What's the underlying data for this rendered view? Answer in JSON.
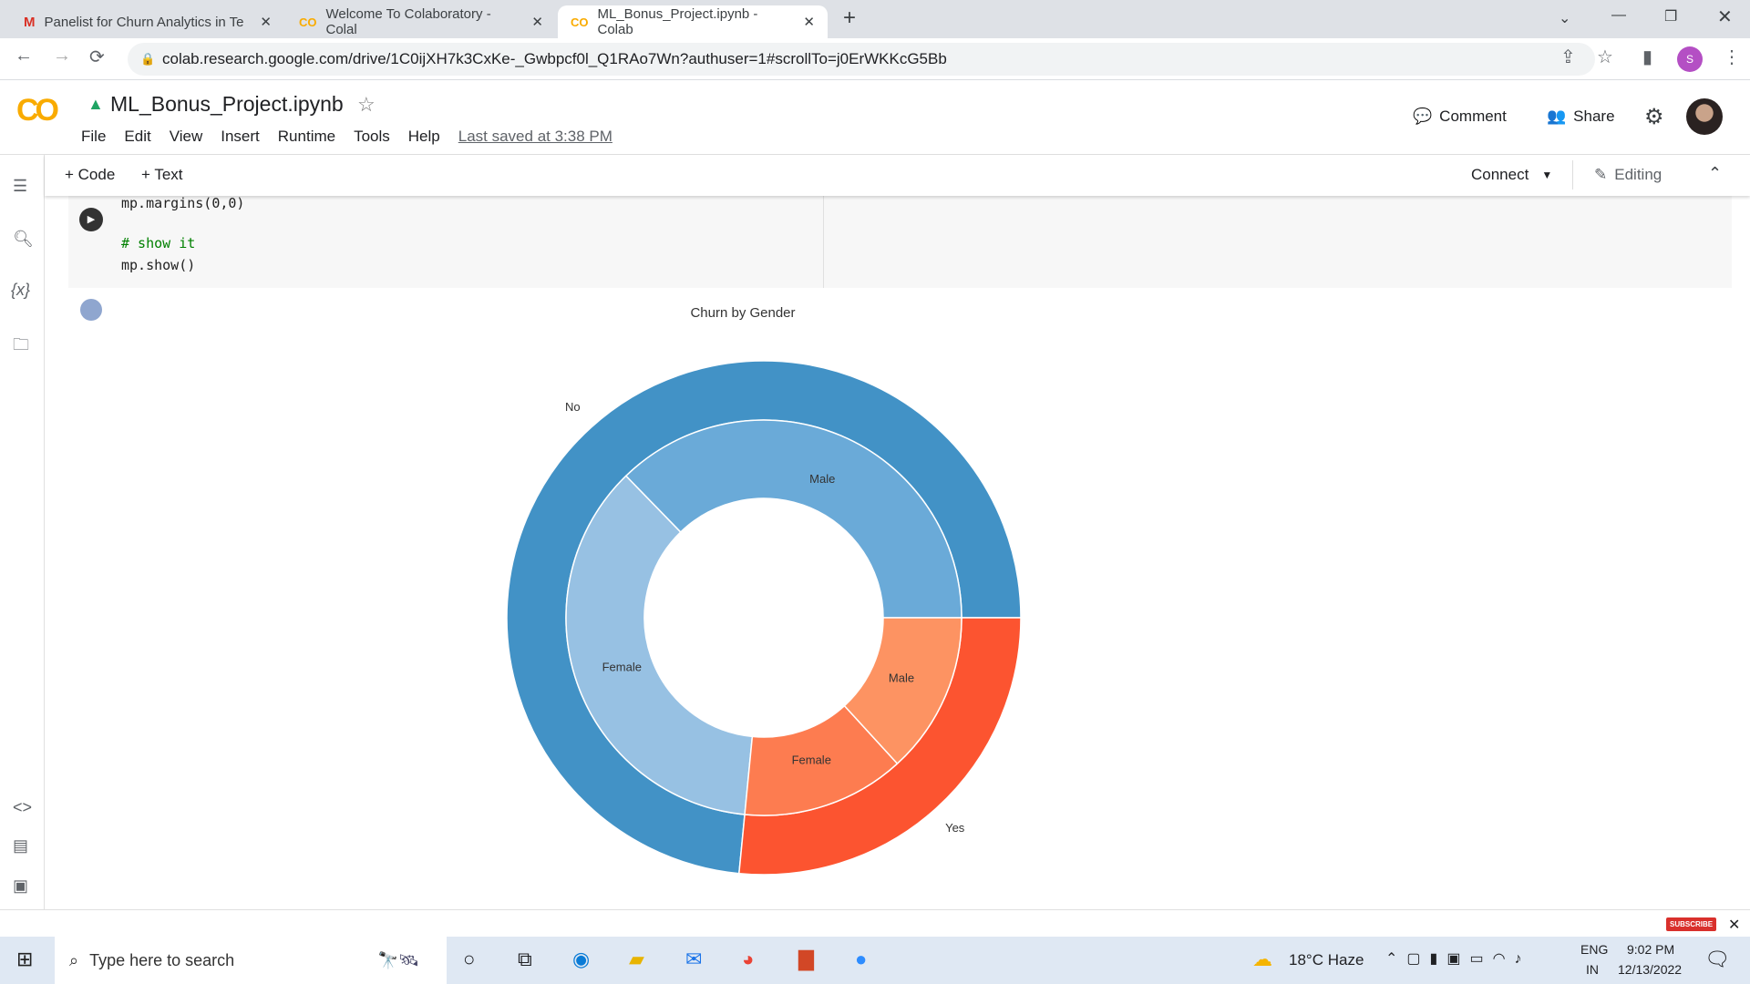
{
  "browser": {
    "tabs": [
      {
        "title": "Panelist for Churn Analytics in Te",
        "icon": "gmail-icon"
      },
      {
        "title": "Welcome To Colaboratory - Colal",
        "icon": "colab-icon"
      },
      {
        "title": "ML_Bonus_Project.ipynb - Colab",
        "icon": "colab-icon",
        "active": true
      }
    ],
    "url": "colab.research.google.com/drive/1C0ijXH7k3CxKe-_Gwbpcf0l_Q1RAo7Wn?authuser=1#scrollTo=j0ErWKKcG5Bb",
    "profile_initial": "S"
  },
  "colab": {
    "logo": "CO",
    "notebook_title": "ML_Bonus_Project.ipynb",
    "menu": [
      "File",
      "Edit",
      "View",
      "Insert",
      "Runtime",
      "Tools",
      "Help"
    ],
    "last_saved": "Last saved at 3:38 PM",
    "comment": "Comment",
    "share": "Share",
    "add_code": "+ Code",
    "add_text": "+ Text",
    "connect": "Connect",
    "editing": "Editing"
  },
  "cell": {
    "lines": [
      "mp.margins(0,0)",
      "",
      "# show it",
      "mp.show()"
    ]
  },
  "chart_data": {
    "type": "pie",
    "title": "Churn by Gender",
    "subtype": "nested donut",
    "outer": {
      "categories": [
        "No",
        "Yes"
      ],
      "values": [
        5174,
        1869
      ],
      "colors": [
        "#4292c6",
        "#fc5430"
      ]
    },
    "inner": {
      "categories": [
        "Male",
        "Female",
        "Female",
        "Male"
      ],
      "parent": [
        "No",
        "No",
        "Yes",
        "Yes"
      ],
      "values": [
        2625,
        2549,
        939,
        930
      ],
      "colors": [
        "#6aaad8",
        "#97c1e3",
        "#fd7c50",
        "#fd9362"
      ]
    }
  },
  "taskbar": {
    "search_placeholder": "Type here to search",
    "weather": "18°C  Haze",
    "lang": "ENG",
    "region": "IN",
    "time": "9:02 PM",
    "date": "12/13/2022",
    "subscribe": "SUBSCRIBE"
  }
}
